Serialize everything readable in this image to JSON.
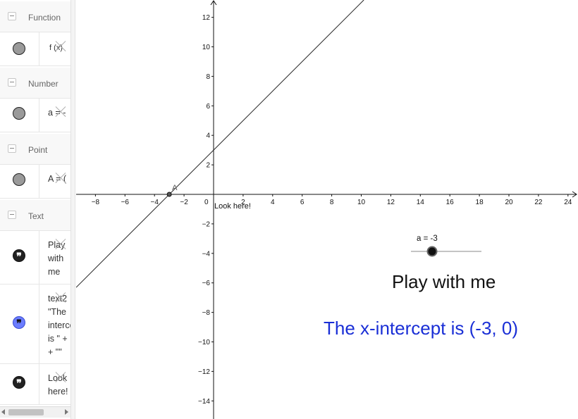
{
  "algebra": {
    "groups": {
      "function": {
        "title": "Function"
      },
      "number": {
        "title": "Number"
      },
      "point": {
        "title": "Point"
      },
      "text": {
        "title": "Text"
      }
    },
    "items": {
      "f": {
        "text": "f (x)"
      },
      "a": {
        "text": "a = -"
      },
      "A": {
        "text": "A = ("
      },
      "text1": {
        "text": "Play\nwith\nme"
      },
      "text2": {
        "text": "text2\n\"The\nintercep\nis \" +\n+ \"\""
      },
      "text3": {
        "text": "Look\nhere!"
      }
    }
  },
  "graphics": {
    "slider_label": "a = -3",
    "title_text": "Play with me",
    "intercept_text": "The x-intercept is (-3, 0)",
    "look_here": "Look here!",
    "point_label": "A",
    "colors": {
      "intercept_text": "#1a2fd6",
      "axes": "#111111"
    }
  },
  "chart_data": {
    "type": "line",
    "x_ticks": [
      -8,
      -6,
      -4,
      -2,
      2,
      4,
      6,
      8,
      10,
      12,
      14,
      16,
      18,
      20,
      22,
      24
    ],
    "y_ticks": [
      12,
      10,
      8,
      6,
      4,
      2,
      -2,
      -4,
      -6,
      -8,
      -10,
      -12,
      -14
    ],
    "origin_label": "0",
    "xlim": [
      -9.2,
      24.8
    ],
    "ylim": [
      -15.2,
      13.2
    ],
    "line": {
      "slope": 1,
      "intercept": 3
    },
    "point": {
      "x": -3,
      "y": 0
    },
    "slider": {
      "value": -3,
      "min": -5,
      "max": 5
    }
  }
}
